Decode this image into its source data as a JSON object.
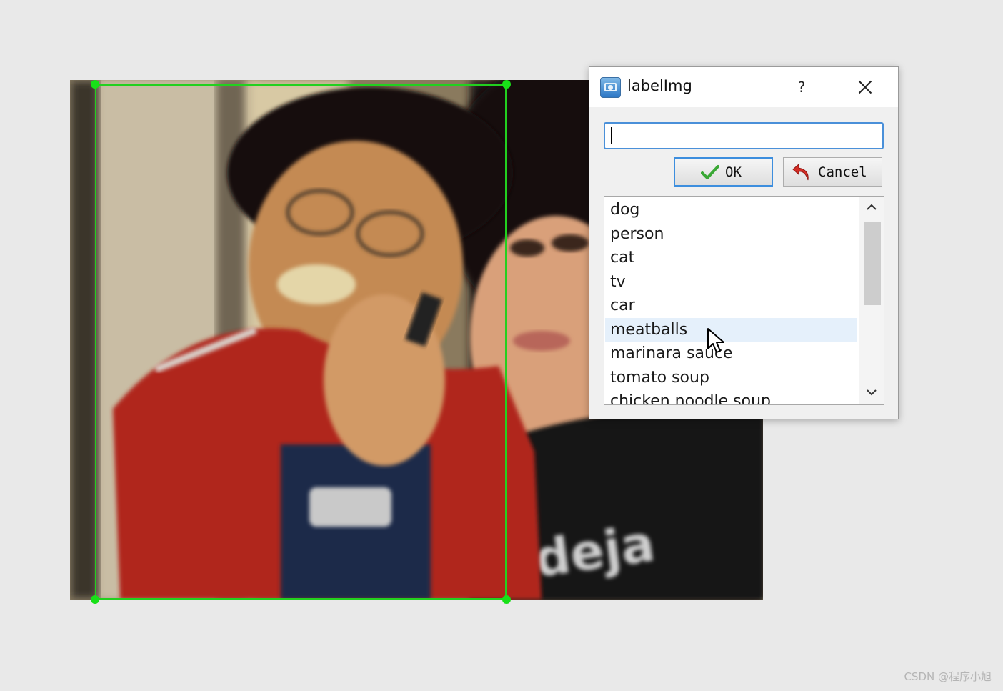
{
  "dialog": {
    "title": "labelImg",
    "help_label": "?",
    "input_value": "",
    "ok_label": "OK",
    "cancel_label": "Cancel",
    "label_list": [
      "dog",
      "person",
      "cat",
      "tv",
      "car",
      "meatballs",
      "marinara sauce",
      "tomato soup",
      "chicken noodle soup"
    ],
    "hovered_item": "meatballs"
  },
  "watermark": "CSDN @程序小旭",
  "colors": {
    "bbox": "#22d01f",
    "ok_border": "#3d8ede",
    "hover_row": "#e5f0fb"
  }
}
